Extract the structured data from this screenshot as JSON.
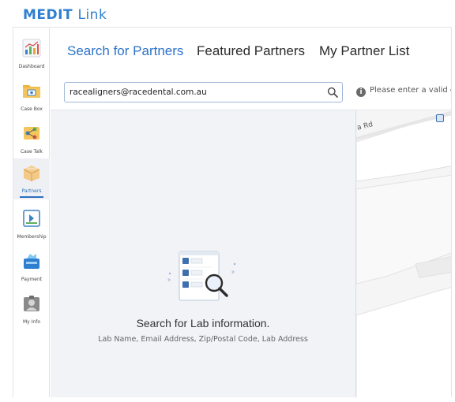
{
  "app": {
    "name_bold": "MEDIT",
    "name_light": "Link"
  },
  "sidebar": {
    "items": [
      {
        "label": "Dashboard",
        "icon": "chart-icon"
      },
      {
        "label": "Case Box",
        "icon": "folder-icon"
      },
      {
        "label": "Case Talk",
        "icon": "share-icon"
      },
      {
        "label": "Partners",
        "icon": "box-icon",
        "active": true
      },
      {
        "label": "Membership",
        "icon": "membership-icon"
      },
      {
        "label": "Payment",
        "icon": "payment-icon"
      },
      {
        "label": "My Info",
        "icon": "user-icon"
      }
    ]
  },
  "tabs": [
    {
      "label": "Search for Partners",
      "active": true
    },
    {
      "label": "Featured Partners"
    },
    {
      "label": "My Partner List"
    }
  ],
  "search": {
    "value": "racealigners@racedental.com.au",
    "hint": "Please enter a valid em"
  },
  "empty_state": {
    "title": "Search for Lab information.",
    "subtitle": "Lab Name, Email Address, Zip/Postal Code, Lab Address"
  },
  "map": {
    "road_label": "a Rd"
  },
  "colors": {
    "accent": "#2c72c8",
    "brand": "#2f7fd1"
  }
}
